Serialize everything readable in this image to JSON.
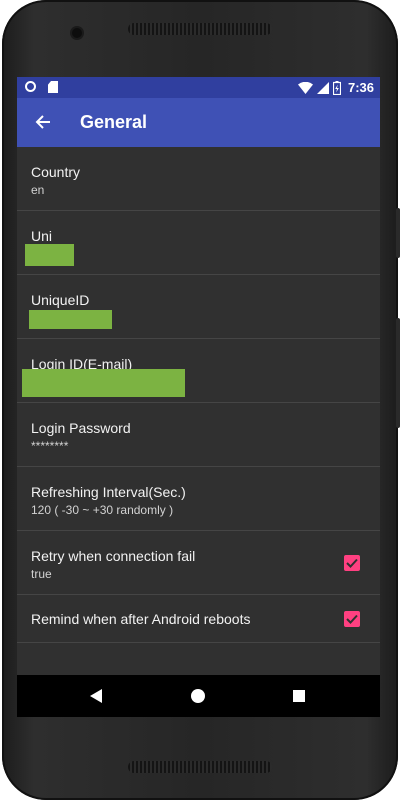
{
  "status_bar": {
    "time": "7:36",
    "icons": [
      "record-icon",
      "sd-card-icon",
      "wifi-icon",
      "signal-icon",
      "battery-charging-icon"
    ]
  },
  "app_bar": {
    "title": "General",
    "back_icon": "arrow-back-icon",
    "background": "#3f51b5",
    "status_background": "#303f9f"
  },
  "preferences": [
    {
      "title": "Country",
      "summary": "en"
    },
    {
      "title": "Uni",
      "summary": ""
    },
    {
      "title": "UniqueID",
      "summary": ""
    },
    {
      "title": "Login ID(E-mail)",
      "summary": ""
    },
    {
      "title": "Login Password",
      "summary": "********"
    },
    {
      "title": "Refreshing Interval(Sec.)",
      "summary": "120 ( -30 ~ +30 randomly )"
    },
    {
      "title": "Retry when connection fail",
      "summary": "true",
      "checked": true
    },
    {
      "title": "Remind when after Android reboots",
      "checked": true
    }
  ],
  "nav_bar": {
    "icons": [
      "back-triangle-icon",
      "home-circle-icon",
      "recents-square-icon"
    ]
  },
  "colors": {
    "accent": "#ff4081",
    "redaction": "#7cb342",
    "background": "#303030"
  }
}
